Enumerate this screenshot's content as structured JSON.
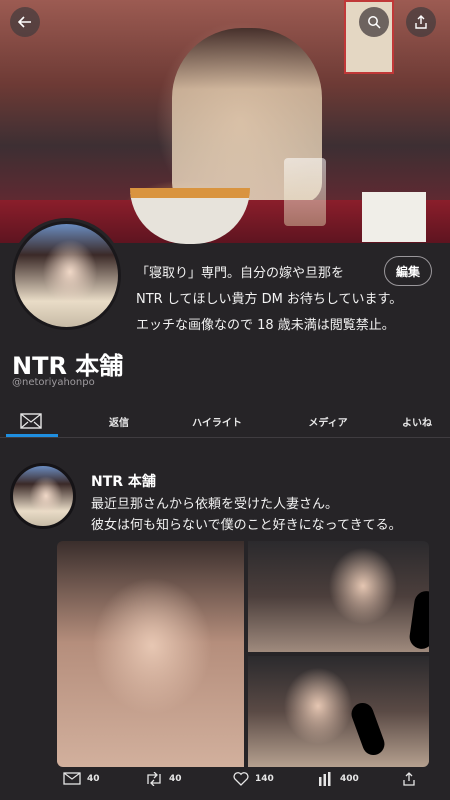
{
  "header": {
    "back_icon": "arrow-left-icon",
    "search_icon": "search-icon",
    "share_icon": "share-icon"
  },
  "profile": {
    "display_name": "NTR 本舗",
    "handle": "@netoriyahonpo",
    "edit_label": "編集",
    "bio_lines": [
      "「寝取り」専門。自分の嫁や旦那を",
      "NTR してほしい貴方 DM お待ちしています。",
      "エッチな画像なので 18 歳未満は閲覧禁止。"
    ]
  },
  "tabs": [
    {
      "label": "",
      "icon": "mail-icon",
      "active": true
    },
    {
      "label": "返信"
    },
    {
      "label": "ハイライト"
    },
    {
      "label": "メディア"
    },
    {
      "label": "よいね"
    }
  ],
  "tweet": {
    "name": "NTR 本舗",
    "text_lines": [
      "最近旦那さんから依頼を受けた人妻さん。",
      "彼女は何も知らないで僕のこと好きになってきてる。"
    ],
    "actions": {
      "mail_count": "40",
      "retweet_count": "40",
      "like_count": "140",
      "view_count": "400"
    }
  },
  "colors": {
    "background": "#262427",
    "accent": "#1f8fe0"
  }
}
